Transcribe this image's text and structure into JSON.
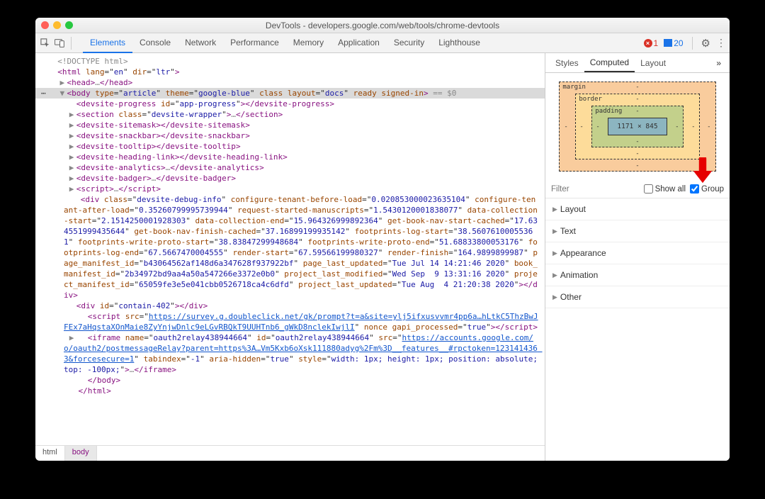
{
  "titlebar": {
    "title": "DevTools - developers.google.com/web/tools/chrome-devtools",
    "dot_colors": [
      "#ff5f57",
      "#febc2e",
      "#28c840"
    ]
  },
  "toolbar": {
    "tabs": [
      "Elements",
      "Console",
      "Network",
      "Performance",
      "Memory",
      "Application",
      "Security",
      "Lighthouse"
    ],
    "active_tab_index": 0,
    "error_count": "1",
    "message_count": "20"
  },
  "dom": {
    "doctype": "<!DOCTYPE html>",
    "selected_index": 3,
    "lines": [
      {
        "indent": 0,
        "arrow": "",
        "html": "<span class='gray'>&lt;!DOCTYPE html&gt;</span>"
      },
      {
        "indent": 0,
        "arrow": "",
        "html": "<span class='tag-punc'>&lt;</span><span class='tag-name'>html</span> <span class='attr-name'>lang</span>=\"<span class='attr-val'>en</span>\" <span class='attr-name'>dir</span>=\"<span class='attr-val'>ltr</span>\"<span class='tag-punc'>&gt;</span>"
      },
      {
        "indent": 1,
        "arrow": "▶",
        "html": "<span class='tag-punc'>&lt;</span><span class='tag-name'>head</span><span class='tag-punc'>&gt;</span><span class='gray'>…</span><span class='tag-punc'>&lt;/</span><span class='tag-name'>head</span><span class='tag-punc'>&gt;</span>"
      },
      {
        "indent": 1,
        "arrow": "▼",
        "sel": true,
        "prefix": "⋯",
        "html": "<span class='tag-punc'>&lt;</span><span class='tag-name'>body</span> <span class='attr-name'>type</span>=\"<span class='attr-val'>article</span>\" <span class='attr-name'>theme</span>=\"<span class='attr-val'>google-blue</span>\" <span class='attr-name'>class</span> <span class='attr-name'>layout</span>=\"<span class='attr-val'>docs</span>\" <span class='attr-name'>ready</span> <span class='attr-name'>signed-in</span><span class='tag-punc'>&gt;</span> <span class='gray'>== $0</span>"
      },
      {
        "indent": 2,
        "arrow": "",
        "html": "<span class='tag-punc'>&lt;</span><span class='tag-name'>devsite-progress</span> <span class='attr-name'>id</span>=\"<span class='attr-val'>app-progress</span>\"<span class='tag-punc'>&gt;&lt;/</span><span class='tag-name'>devsite-progress</span><span class='tag-punc'>&gt;</span>"
      },
      {
        "indent": 2,
        "arrow": "▶",
        "html": "<span class='tag-punc'>&lt;</span><span class='tag-name'>section</span> <span class='attr-name'>class</span>=\"<span class='attr-val'>devsite-wrapper</span>\"<span class='tag-punc'>&gt;</span><span class='gray'>…</span><span class='tag-punc'>&lt;/</span><span class='tag-name'>section</span><span class='tag-punc'>&gt;</span>"
      },
      {
        "indent": 2,
        "arrow": "▶",
        "html": "<span class='tag-punc'>&lt;</span><span class='tag-name'>devsite-sitemask</span><span class='tag-punc'>&gt;&lt;/</span><span class='tag-name'>devsite-sitemask</span><span class='tag-punc'>&gt;</span>"
      },
      {
        "indent": 2,
        "arrow": "▶",
        "html": "<span class='tag-punc'>&lt;</span><span class='tag-name'>devsite-snackbar</span><span class='tag-punc'>&gt;&lt;/</span><span class='tag-name'>devsite-snackbar</span><span class='tag-punc'>&gt;</span>"
      },
      {
        "indent": 2,
        "arrow": "▶",
        "html": "<span class='tag-punc'>&lt;</span><span class='tag-name'>devsite-tooltip</span><span class='tag-punc'>&gt;&lt;/</span><span class='tag-name'>devsite-tooltip</span><span class='tag-punc'>&gt;</span>"
      },
      {
        "indent": 2,
        "arrow": "▶",
        "html": "<span class='tag-punc'>&lt;</span><span class='tag-name'>devsite-heading-link</span><span class='tag-punc'>&gt;&lt;/</span><span class='tag-name'>devsite-heading-link</span><span class='tag-punc'>&gt;</span>"
      },
      {
        "indent": 2,
        "arrow": "▶",
        "html": "<span class='tag-punc'>&lt;</span><span class='tag-name'>devsite-analytics</span><span class='tag-punc'>&gt;</span><span class='gray'>…</span><span class='tag-punc'>&lt;/</span><span class='tag-name'>devsite-analytics</span><span class='tag-punc'>&gt;</span>"
      },
      {
        "indent": 2,
        "arrow": "▶",
        "html": "<span class='tag-punc'>&lt;</span><span class='tag-name'>devsite-badger</span><span class='tag-punc'>&gt;</span><span class='gray'>…</span><span class='tag-punc'>&lt;/</span><span class='tag-name'>devsite-badger</span><span class='tag-punc'>&gt;</span>"
      },
      {
        "indent": 2,
        "arrow": "▶",
        "html": "<span class='tag-punc'>&lt;</span><span class='tag-name'>script</span><span class='tag-punc'>&gt;</span><span class='gray'>…</span><span class='tag-punc'>&lt;/</span><span class='tag-name'>script</span><span class='tag-punc'>&gt;</span>"
      },
      {
        "indent": 2,
        "arrow": "",
        "html": "<span class='tag-punc'>&lt;</span><span class='tag-name'>div</span> <span class='attr-name'>id</span>=\"<span class='attr-val'>contain-402</span>\"<span class='tag-punc'>&gt;&lt;/</span><span class='tag-name'>div</span><span class='tag-punc'>&gt;</span>"
      },
      {
        "indent": 2,
        "arrow": "",
        "html": "<span class='tag-punc'>&lt;</span><span class='tag-name'>script</span> <span class='attr-name'>src</span>=\"<span class='attr-link'>https://survey.g.doubleclick.net/gk/prompt?t=a&amp;site=ylj5ifxusvvmr4pp6a…hLtkC5ThzBwJFEx7aHqstaXOnMaie8ZyYnjwDnlc9eLGvRBQkT9UUHTnb6_gWkD8nclekIwjlI</span>\" <span class='attr-name'>nonce</span> <span class='attr-name'>gapi_processed</span>=\"<span class='attr-val'>true</span>\"<span class='tag-punc'>&gt;&lt;/</span><span class='tag-name'>script</span><span class='tag-punc'>&gt;</span>"
      },
      {
        "indent": 2,
        "arrow": "▶",
        "html": "<span class='tag-punc'>&lt;</span><span class='tag-name'>iframe</span> <span class='attr-name'>name</span>=\"<span class='attr-val'>oauth2relay438944664</span>\" <span class='attr-name'>id</span>=\"<span class='attr-val'>oauth2relay438944664</span>\" <span class='attr-name'>src</span>=\"<span class='attr-link'>https://accounts.google.com/o/oauth2/postmessageRelay?parent=https%3A…Vm5Kxb6oXsk111880adyg%2Fm%3D__features__#rpctoken=123141436 3&amp;forcesecure=1</span>\" <span class='attr-name'>tabindex</span>=\"<span class='attr-val'>-1</span>\" <span class='attr-name'>aria-hidden</span>=\"<span class='attr-val'>true</span>\" <span class='attr-name'>style</span>=\"<span class='attr-val'>width: 1px; height: 1px; position: absolute; top: -100px;</span>\"<span class='tag-punc'>&gt;</span><span class='gray'>…</span><span class='tag-punc'>&lt;/</span><span class='tag-name'>iframe</span><span class='tag-punc'>&gt;</span>"
      },
      {
        "indent": 2,
        "arrow": "",
        "html": "<span class='tag-punc'>&lt;/</span><span class='tag-name'>body</span><span class='tag-punc'>&gt;</span>"
      },
      {
        "indent": 1,
        "arrow": "",
        "html": "<span class='tag-punc'>&lt;/</span><span class='tag-name'>html</span><span class='tag-punc'>&gt;</span>"
      }
    ],
    "debug_div": {
      "open": "<div class=\"devsite-debug-info\" ",
      "attrs": "configure-tenant-before-load=\"0.020853000023635104\" configure-tenant-after-load=\"0.35260799995739944\" request-started-manuscripts=\"1.5430120001838077\" data-collection-start=\"2.1514250001928303\" data-collection-end=\"15.964326999892364\" get-book-nav-start-cached=\"17.634551999435644\" get-book-nav-finish-cached=\"37.16899199935142\" footprints-log-start=\"38.56076100055361\" footprints-write-proto-start=\"38.83847299948684\" footprints-write-proto-end=\"51.68833800053176\" footprints-log-end=\"67.5667470004555\" render-start=\"67.59566199980327\" render-finish=\"164.9899899987\" page_manifest_id=\"b43064562af148d6a347628f937922bf\" page_last_updated=\"Tue Jul 14 14:21:46 2020\" book_manifest_id=\"2b34972bd9aa4a50a547266e3372e0b0\" project_last_modified=\"Wed Sep  9 13:31:16 2020\" project_manifest_id=\"65059fe3e5e041cbb0526718ca4c6dfd\" project_last_updated=\"Tue Aug  4 21:20:38 2020\"",
      "close": "></div>"
    }
  },
  "breadcrumb": [
    "html",
    "body"
  ],
  "sidebar": {
    "tabs": [
      "Styles",
      "Computed",
      "Layout"
    ],
    "active_tab_index": 1,
    "more": "»",
    "box_model": {
      "margin_label": "margin",
      "border_label": "border",
      "padding_label": "padding",
      "content": "1171 × 845",
      "dash": "-"
    },
    "filter_placeholder": "Filter",
    "show_all_label": "Show all",
    "show_all_checked": false,
    "group_label": "Group",
    "group_checked": true,
    "groups": [
      "Layout",
      "Text",
      "Appearance",
      "Animation",
      "Other"
    ]
  }
}
